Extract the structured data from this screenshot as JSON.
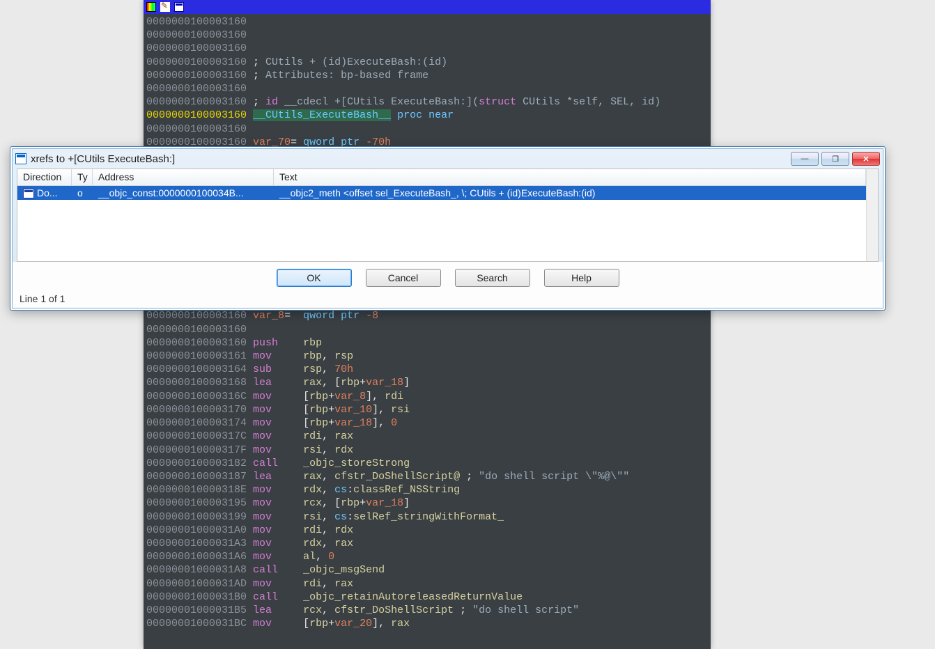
{
  "disasm": {
    "lines": [
      {
        "segments": [
          {
            "t": "0000000100003160",
            "c": "addr"
          }
        ]
      },
      {
        "segments": [
          {
            "t": "0000000100003160",
            "c": "addr"
          }
        ]
      },
      {
        "segments": [
          {
            "t": "0000000100003160",
            "c": "addr"
          }
        ]
      },
      {
        "segments": [
          {
            "t": "0000000100003160",
            "c": "addr"
          },
          {
            "t": " ; ",
            "c": "white-op"
          },
          {
            "t": "CUtils",
            "c": "comment"
          },
          {
            "t": " + (id)",
            "c": "comment"
          },
          {
            "t": "ExecuteBash",
            "c": "comment"
          },
          {
            "t": ":(id)",
            "c": "comment"
          }
        ]
      },
      {
        "segments": [
          {
            "t": "0000000100003160",
            "c": "addr"
          },
          {
            "t": " ; ",
            "c": "white-op"
          },
          {
            "t": "Attributes: bp-based frame",
            "c": "comment"
          }
        ]
      },
      {
        "segments": [
          {
            "t": "0000000100003160",
            "c": "addr"
          }
        ]
      },
      {
        "segments": [
          {
            "t": "0000000100003160",
            "c": "addr"
          },
          {
            "t": " ; ",
            "c": "white-op"
          },
          {
            "t": "id",
            "c": "comment-kw"
          },
          {
            "t": " __cdecl ",
            "c": "comment"
          },
          {
            "t": "+[CUtils ExecuteBash:]",
            "c": "comment"
          },
          {
            "t": "(",
            "c": "comment"
          },
          {
            "t": "struct",
            "c": "comment-kw"
          },
          {
            "t": " CUtils *self, SEL, id)",
            "c": "comment"
          }
        ]
      },
      {
        "segments": [
          {
            "t": "0000000100003160",
            "c": "addr-hl"
          },
          {
            "t": " ",
            "c": ""
          },
          {
            "t": "__CUtils_ExecuteBash__",
            "c": "func-name"
          },
          {
            "t": " ",
            "c": ""
          },
          {
            "t": "proc near",
            "c": "proc-kw"
          }
        ]
      },
      {
        "segments": [
          {
            "t": "0000000100003160",
            "c": "addr"
          }
        ]
      },
      {
        "segments": [
          {
            "t": "0000000100003160",
            "c": "addr"
          },
          {
            "t": " ",
            "c": ""
          },
          {
            "t": "var_70",
            "c": "str"
          },
          {
            "t": "= ",
            "c": "white-op"
          },
          {
            "t": "qword ptr ",
            "c": "proc-kw"
          },
          {
            "t": "-70h",
            "c": "str"
          }
        ]
      },
      {
        "segments": [
          {
            "t": "",
            "c": ""
          }
        ]
      },
      {
        "segments": [
          {
            "t": "",
            "c": ""
          }
        ]
      },
      {
        "segments": [
          {
            "t": "",
            "c": ""
          }
        ]
      },
      {
        "segments": [
          {
            "t": "",
            "c": ""
          }
        ]
      },
      {
        "segments": [
          {
            "t": "",
            "c": ""
          }
        ]
      },
      {
        "segments": [
          {
            "t": "",
            "c": ""
          }
        ]
      },
      {
        "segments": [
          {
            "t": "",
            "c": ""
          }
        ]
      },
      {
        "segments": [
          {
            "t": "",
            "c": ""
          }
        ]
      },
      {
        "segments": [
          {
            "t": "",
            "c": ""
          }
        ]
      },
      {
        "segments": [
          {
            "t": "",
            "c": ""
          }
        ]
      },
      {
        "segments": [
          {
            "t": "",
            "c": ""
          }
        ]
      },
      {
        "segments": [
          {
            "t": "",
            "c": ""
          }
        ]
      },
      {
        "segments": [
          {
            "t": "0000000100003160",
            "c": "addr"
          },
          {
            "t": " ",
            "c": ""
          },
          {
            "t": "var_8",
            "c": "str"
          },
          {
            "t": "=  ",
            "c": "white-op"
          },
          {
            "t": "qword ptr ",
            "c": "proc-kw"
          },
          {
            "t": "-8",
            "c": "str"
          }
        ]
      },
      {
        "segments": [
          {
            "t": "0000000100003160",
            "c": "addr"
          }
        ]
      },
      {
        "segments": [
          {
            "t": "0000000100003160",
            "c": "addr"
          },
          {
            "t": " ",
            "c": ""
          },
          {
            "t": "push",
            "c": "keyword"
          },
          {
            "t": "    ",
            "c": ""
          },
          {
            "t": "rbp",
            "c": "reg"
          }
        ]
      },
      {
        "segments": [
          {
            "t": "0000000100003161",
            "c": "addr"
          },
          {
            "t": " ",
            "c": ""
          },
          {
            "t": "mov",
            "c": "keyword"
          },
          {
            "t": "     ",
            "c": ""
          },
          {
            "t": "rbp",
            "c": "reg"
          },
          {
            "t": ", ",
            "c": "white-op"
          },
          {
            "t": "rsp",
            "c": "reg"
          }
        ]
      },
      {
        "segments": [
          {
            "t": "0000000100003164",
            "c": "addr"
          },
          {
            "t": " ",
            "c": ""
          },
          {
            "t": "sub",
            "c": "keyword"
          },
          {
            "t": "     ",
            "c": ""
          },
          {
            "t": "rsp",
            "c": "reg"
          },
          {
            "t": ", ",
            "c": "white-op"
          },
          {
            "t": "70h",
            "c": "str"
          }
        ]
      },
      {
        "segments": [
          {
            "t": "0000000100003168",
            "c": "addr"
          },
          {
            "t": " ",
            "c": ""
          },
          {
            "t": "lea",
            "c": "keyword"
          },
          {
            "t": "     ",
            "c": ""
          },
          {
            "t": "rax",
            "c": "reg"
          },
          {
            "t": ", [",
            "c": "white-op"
          },
          {
            "t": "rbp",
            "c": "reg"
          },
          {
            "t": "+",
            "c": "white-op"
          },
          {
            "t": "var_18",
            "c": "str"
          },
          {
            "t": "]",
            "c": "white-op"
          }
        ]
      },
      {
        "segments": [
          {
            "t": "000000010000316C",
            "c": "addr"
          },
          {
            "t": " ",
            "c": ""
          },
          {
            "t": "mov",
            "c": "keyword"
          },
          {
            "t": "     [",
            "c": "white-op"
          },
          {
            "t": "rbp",
            "c": "reg"
          },
          {
            "t": "+",
            "c": "white-op"
          },
          {
            "t": "var_8",
            "c": "str"
          },
          {
            "t": "], ",
            "c": "white-op"
          },
          {
            "t": "rdi",
            "c": "reg"
          }
        ]
      },
      {
        "segments": [
          {
            "t": "0000000100003170",
            "c": "addr"
          },
          {
            "t": " ",
            "c": ""
          },
          {
            "t": "mov",
            "c": "keyword"
          },
          {
            "t": "     [",
            "c": "white-op"
          },
          {
            "t": "rbp",
            "c": "reg"
          },
          {
            "t": "+",
            "c": "white-op"
          },
          {
            "t": "var_10",
            "c": "str"
          },
          {
            "t": "], ",
            "c": "white-op"
          },
          {
            "t": "rsi",
            "c": "reg"
          }
        ]
      },
      {
        "segments": [
          {
            "t": "0000000100003174",
            "c": "addr"
          },
          {
            "t": " ",
            "c": ""
          },
          {
            "t": "mov",
            "c": "keyword"
          },
          {
            "t": "     [",
            "c": "white-op"
          },
          {
            "t": "rbp",
            "c": "reg"
          },
          {
            "t": "+",
            "c": "white-op"
          },
          {
            "t": "var_18",
            "c": "str"
          },
          {
            "t": "], ",
            "c": "white-op"
          },
          {
            "t": "0",
            "c": "str"
          }
        ]
      },
      {
        "segments": [
          {
            "t": "000000010000317C",
            "c": "addr"
          },
          {
            "t": " ",
            "c": ""
          },
          {
            "t": "mov",
            "c": "keyword"
          },
          {
            "t": "     ",
            "c": ""
          },
          {
            "t": "rdi",
            "c": "reg"
          },
          {
            "t": ", ",
            "c": "white-op"
          },
          {
            "t": "rax",
            "c": "reg"
          }
        ]
      },
      {
        "segments": [
          {
            "t": "000000010000317F",
            "c": "addr"
          },
          {
            "t": " ",
            "c": ""
          },
          {
            "t": "mov",
            "c": "keyword"
          },
          {
            "t": "     ",
            "c": ""
          },
          {
            "t": "rsi",
            "c": "reg"
          },
          {
            "t": ", ",
            "c": "white-op"
          },
          {
            "t": "rdx",
            "c": "reg"
          }
        ]
      },
      {
        "segments": [
          {
            "t": "0000000100003182",
            "c": "addr"
          },
          {
            "t": " ",
            "c": ""
          },
          {
            "t": "call",
            "c": "keyword"
          },
          {
            "t": "    ",
            "c": ""
          },
          {
            "t": "_objc_storeStrong",
            "c": "yellow-txt"
          }
        ]
      },
      {
        "segments": [
          {
            "t": "0000000100003187",
            "c": "addr"
          },
          {
            "t": " ",
            "c": ""
          },
          {
            "t": "lea",
            "c": "keyword"
          },
          {
            "t": "     ",
            "c": ""
          },
          {
            "t": "rax",
            "c": "reg"
          },
          {
            "t": ", ",
            "c": "white-op"
          },
          {
            "t": "cfstr_DoShellScript@",
            "c": "yellow-txt"
          },
          {
            "t": " ; ",
            "c": "white-op"
          },
          {
            "t": "\"do shell script \\\"%@\\\"\"",
            "c": "comment"
          }
        ]
      },
      {
        "segments": [
          {
            "t": "000000010000318E",
            "c": "addr"
          },
          {
            "t": " ",
            "c": ""
          },
          {
            "t": "mov",
            "c": "keyword"
          },
          {
            "t": "     ",
            "c": ""
          },
          {
            "t": "rdx",
            "c": "reg"
          },
          {
            "t": ", ",
            "c": "white-op"
          },
          {
            "t": "cs",
            "c": "proc-kw"
          },
          {
            "t": ":",
            "c": "white-op"
          },
          {
            "t": "classRef_NSString",
            "c": "yellow-txt"
          }
        ]
      },
      {
        "segments": [
          {
            "t": "0000000100003195",
            "c": "addr"
          },
          {
            "t": " ",
            "c": ""
          },
          {
            "t": "mov",
            "c": "keyword"
          },
          {
            "t": "     ",
            "c": ""
          },
          {
            "t": "rcx",
            "c": "reg"
          },
          {
            "t": ", [",
            "c": "white-op"
          },
          {
            "t": "rbp",
            "c": "reg"
          },
          {
            "t": "+",
            "c": "white-op"
          },
          {
            "t": "var_18",
            "c": "str"
          },
          {
            "t": "]",
            "c": "white-op"
          }
        ]
      },
      {
        "segments": [
          {
            "t": "0000000100003199",
            "c": "addr"
          },
          {
            "t": " ",
            "c": ""
          },
          {
            "t": "mov",
            "c": "keyword"
          },
          {
            "t": "     ",
            "c": ""
          },
          {
            "t": "rsi",
            "c": "reg"
          },
          {
            "t": ", ",
            "c": "white-op"
          },
          {
            "t": "cs",
            "c": "proc-kw"
          },
          {
            "t": ":",
            "c": "white-op"
          },
          {
            "t": "selRef_stringWithFormat_",
            "c": "yellow-txt"
          }
        ]
      },
      {
        "segments": [
          {
            "t": "00000001000031A0",
            "c": "addr"
          },
          {
            "t": " ",
            "c": ""
          },
          {
            "t": "mov",
            "c": "keyword"
          },
          {
            "t": "     ",
            "c": ""
          },
          {
            "t": "rdi",
            "c": "reg"
          },
          {
            "t": ", ",
            "c": "white-op"
          },
          {
            "t": "rdx",
            "c": "reg"
          }
        ]
      },
      {
        "segments": [
          {
            "t": "00000001000031A3",
            "c": "addr"
          },
          {
            "t": " ",
            "c": ""
          },
          {
            "t": "mov",
            "c": "keyword"
          },
          {
            "t": "     ",
            "c": ""
          },
          {
            "t": "rdx",
            "c": "reg"
          },
          {
            "t": ", ",
            "c": "white-op"
          },
          {
            "t": "rax",
            "c": "reg"
          }
        ]
      },
      {
        "segments": [
          {
            "t": "00000001000031A6",
            "c": "addr"
          },
          {
            "t": " ",
            "c": ""
          },
          {
            "t": "mov",
            "c": "keyword"
          },
          {
            "t": "     ",
            "c": ""
          },
          {
            "t": "al",
            "c": "reg"
          },
          {
            "t": ", ",
            "c": "white-op"
          },
          {
            "t": "0",
            "c": "str"
          }
        ]
      },
      {
        "segments": [
          {
            "t": "00000001000031A8",
            "c": "addr"
          },
          {
            "t": " ",
            "c": ""
          },
          {
            "t": "call",
            "c": "keyword"
          },
          {
            "t": "    ",
            "c": ""
          },
          {
            "t": "_objc_msgSend",
            "c": "yellow-txt"
          }
        ]
      },
      {
        "segments": [
          {
            "t": "00000001000031AD",
            "c": "addr"
          },
          {
            "t": " ",
            "c": ""
          },
          {
            "t": "mov",
            "c": "keyword"
          },
          {
            "t": "     ",
            "c": ""
          },
          {
            "t": "rdi",
            "c": "reg"
          },
          {
            "t": ", ",
            "c": "white-op"
          },
          {
            "t": "rax",
            "c": "reg"
          }
        ]
      },
      {
        "segments": [
          {
            "t": "00000001000031B0",
            "c": "addr"
          },
          {
            "t": " ",
            "c": ""
          },
          {
            "t": "call",
            "c": "keyword"
          },
          {
            "t": "    ",
            "c": ""
          },
          {
            "t": "_objc_retainAutoreleasedReturnValue",
            "c": "yellow-txt"
          }
        ]
      },
      {
        "segments": [
          {
            "t": "00000001000031B5",
            "c": "addr"
          },
          {
            "t": " ",
            "c": ""
          },
          {
            "t": "lea",
            "c": "keyword"
          },
          {
            "t": "     ",
            "c": ""
          },
          {
            "t": "rcx",
            "c": "reg"
          },
          {
            "t": ", ",
            "c": "white-op"
          },
          {
            "t": "cfstr_DoShellScript",
            "c": "yellow-txt"
          },
          {
            "t": " ; ",
            "c": "white-op"
          },
          {
            "t": "\"do shell script\"",
            "c": "comment"
          }
        ]
      },
      {
        "segments": [
          {
            "t": "00000001000031BC",
            "c": "addr"
          },
          {
            "t": " ",
            "c": ""
          },
          {
            "t": "mov",
            "c": "keyword"
          },
          {
            "t": "     [",
            "c": "white-op"
          },
          {
            "t": "rbp",
            "c": "reg"
          },
          {
            "t": "+",
            "c": "white-op"
          },
          {
            "t": "var_20",
            "c": "str"
          },
          {
            "t": "], ",
            "c": "white-op"
          },
          {
            "t": "rax",
            "c": "reg"
          }
        ]
      }
    ]
  },
  "dialog": {
    "title": "xrefs to +[CUtils ExecuteBash:]",
    "headers": {
      "direction": "Direction",
      "ty": "Ty",
      "address": "Address",
      "text": "Text"
    },
    "rows": [
      {
        "direction": "Do...",
        "ty": "o",
        "address": "__objc_const:0000000100034B...",
        "text": "__objc2_meth <offset sel_ExecuteBash_, \\; CUtils + (id)ExecuteBash:(id)"
      }
    ],
    "buttons": {
      "ok": "OK",
      "cancel": "Cancel",
      "search": "Search",
      "help": "Help"
    },
    "status": "Line 1 of 1"
  },
  "windowControls": {
    "minimize": "—",
    "maximize": "❐",
    "close": "✕"
  }
}
